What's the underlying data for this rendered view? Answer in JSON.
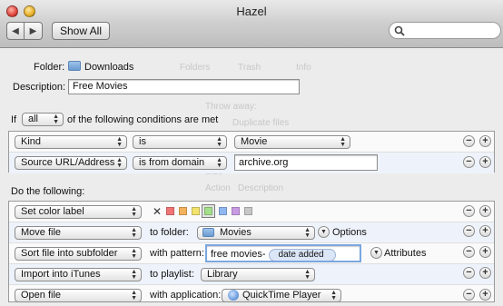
{
  "window": {
    "title": "Hazel"
  },
  "toolbar": {
    "show_all": "Show All"
  },
  "background_ghost": {
    "tabs": [
      "Folders",
      "Trash",
      "Info"
    ],
    "items": [
      "Throw away:",
      "Duplicate files",
      "Size",
      "Action",
      "Description"
    ]
  },
  "rule": {
    "folder_label": "Folder:",
    "folder_name": "Downloads",
    "description_label": "Description:",
    "description_value": "Free Movies",
    "if_label": "If",
    "match_mode": "all",
    "conditions_suffix": "of the following conditions are met",
    "do_label": "Do the following:"
  },
  "conditions": [
    {
      "attribute": "Kind",
      "operator": "is",
      "value": "Movie"
    },
    {
      "attribute": "Source URL/Address",
      "operator": "is from domain",
      "value": "archive.org"
    }
  ],
  "actions": [
    {
      "action": "Set color label",
      "colors": [
        "#f07474",
        "#f5b25c",
        "#f3e36c",
        "#a3e08b",
        "#8fb6f0",
        "#c99be3",
        "#c7c7c7"
      ],
      "selected_index": 3
    },
    {
      "action": "Move file",
      "label": "to folder:",
      "value": "Movies",
      "extra": "Options"
    },
    {
      "action": "Sort file into subfolder",
      "label": "with pattern:",
      "pattern_text": "free movies-",
      "pattern_token": "date added",
      "extra": "Attributes"
    },
    {
      "action": "Import into iTunes",
      "label": "to playlist:",
      "value": "Library"
    },
    {
      "action": "Open file",
      "label": "with application:",
      "value": "QuickTime Player"
    }
  ]
}
